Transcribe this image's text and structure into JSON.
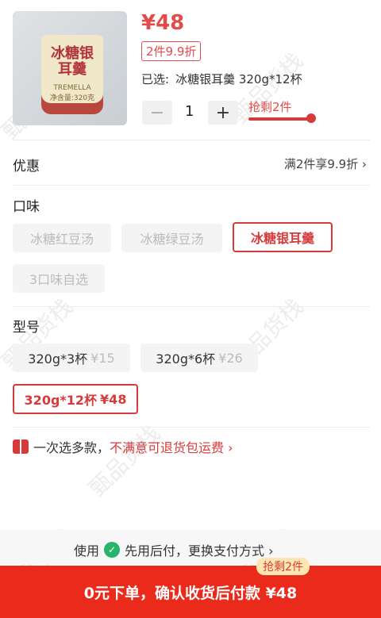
{
  "product": {
    "image_title": "冰糖银耳羹",
    "image_subtitle": "TREMELLA",
    "image_weight": "净含量:320克",
    "price": "¥48",
    "promo_tag": "2件9.9折",
    "selected_label": "已选:",
    "selected_value": "冰糖银耳羹 320g*12杯",
    "qty_minus": "−",
    "qty_value": "1",
    "qty_plus": "+",
    "stock_tag": "抢剩2件"
  },
  "discount": {
    "title": "优惠",
    "info": "满2件享9.9折 ›"
  },
  "flavor": {
    "title": "口味",
    "options": [
      {
        "label": "冰糖红豆汤"
      },
      {
        "label": "冰糖绿豆汤"
      },
      {
        "label": "冰糖银耳羹"
      },
      {
        "label": "3口味自选"
      }
    ]
  },
  "model": {
    "title": "型号",
    "options": [
      {
        "label": "320g*3杯",
        "price": "¥15"
      },
      {
        "label": "320g*6杯",
        "price": "¥26"
      },
      {
        "label": "320g*12杯",
        "price": "¥48"
      }
    ]
  },
  "guarantee": {
    "text": "一次选多款，",
    "highlight": "不满意可退货包运费 ›"
  },
  "pay": {
    "prefix": "使用",
    "method": "先用后付，更换支付方式 ›"
  },
  "cta": {
    "label": "0元下单，确认收货后付款 ¥48",
    "tag": "抢剩2件"
  },
  "watermark": "甄品货栈"
}
